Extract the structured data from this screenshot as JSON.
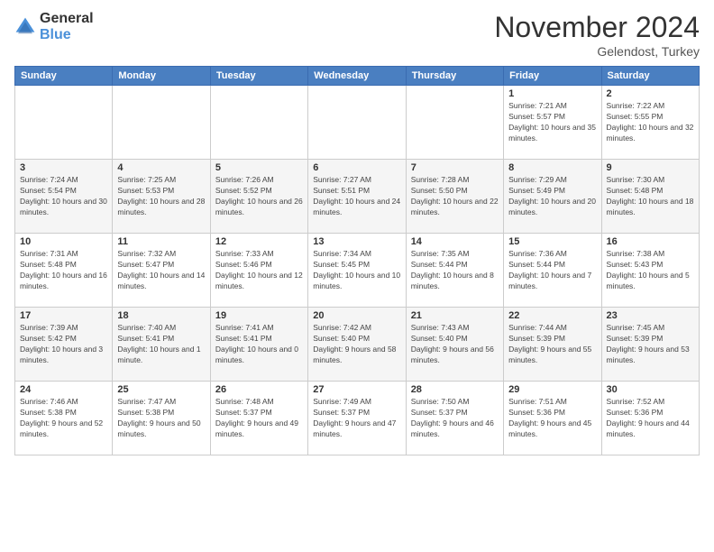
{
  "logo": {
    "general": "General",
    "blue": "Blue"
  },
  "header": {
    "month": "November 2024",
    "location": "Gelendost, Turkey"
  },
  "weekdays": [
    "Sunday",
    "Monday",
    "Tuesday",
    "Wednesday",
    "Thursday",
    "Friday",
    "Saturday"
  ],
  "weeks": [
    [
      {
        "day": "",
        "info": ""
      },
      {
        "day": "",
        "info": ""
      },
      {
        "day": "",
        "info": ""
      },
      {
        "day": "",
        "info": ""
      },
      {
        "day": "",
        "info": ""
      },
      {
        "day": "1",
        "info": "Sunrise: 7:21 AM\nSunset: 5:57 PM\nDaylight: 10 hours and 35 minutes."
      },
      {
        "day": "2",
        "info": "Sunrise: 7:22 AM\nSunset: 5:55 PM\nDaylight: 10 hours and 32 minutes."
      }
    ],
    [
      {
        "day": "3",
        "info": "Sunrise: 7:24 AM\nSunset: 5:54 PM\nDaylight: 10 hours and 30 minutes."
      },
      {
        "day": "4",
        "info": "Sunrise: 7:25 AM\nSunset: 5:53 PM\nDaylight: 10 hours and 28 minutes."
      },
      {
        "day": "5",
        "info": "Sunrise: 7:26 AM\nSunset: 5:52 PM\nDaylight: 10 hours and 26 minutes."
      },
      {
        "day": "6",
        "info": "Sunrise: 7:27 AM\nSunset: 5:51 PM\nDaylight: 10 hours and 24 minutes."
      },
      {
        "day": "7",
        "info": "Sunrise: 7:28 AM\nSunset: 5:50 PM\nDaylight: 10 hours and 22 minutes."
      },
      {
        "day": "8",
        "info": "Sunrise: 7:29 AM\nSunset: 5:49 PM\nDaylight: 10 hours and 20 minutes."
      },
      {
        "day": "9",
        "info": "Sunrise: 7:30 AM\nSunset: 5:48 PM\nDaylight: 10 hours and 18 minutes."
      }
    ],
    [
      {
        "day": "10",
        "info": "Sunrise: 7:31 AM\nSunset: 5:48 PM\nDaylight: 10 hours and 16 minutes."
      },
      {
        "day": "11",
        "info": "Sunrise: 7:32 AM\nSunset: 5:47 PM\nDaylight: 10 hours and 14 minutes."
      },
      {
        "day": "12",
        "info": "Sunrise: 7:33 AM\nSunset: 5:46 PM\nDaylight: 10 hours and 12 minutes."
      },
      {
        "day": "13",
        "info": "Sunrise: 7:34 AM\nSunset: 5:45 PM\nDaylight: 10 hours and 10 minutes."
      },
      {
        "day": "14",
        "info": "Sunrise: 7:35 AM\nSunset: 5:44 PM\nDaylight: 10 hours and 8 minutes."
      },
      {
        "day": "15",
        "info": "Sunrise: 7:36 AM\nSunset: 5:44 PM\nDaylight: 10 hours and 7 minutes."
      },
      {
        "day": "16",
        "info": "Sunrise: 7:38 AM\nSunset: 5:43 PM\nDaylight: 10 hours and 5 minutes."
      }
    ],
    [
      {
        "day": "17",
        "info": "Sunrise: 7:39 AM\nSunset: 5:42 PM\nDaylight: 10 hours and 3 minutes."
      },
      {
        "day": "18",
        "info": "Sunrise: 7:40 AM\nSunset: 5:41 PM\nDaylight: 10 hours and 1 minute."
      },
      {
        "day": "19",
        "info": "Sunrise: 7:41 AM\nSunset: 5:41 PM\nDaylight: 10 hours and 0 minutes."
      },
      {
        "day": "20",
        "info": "Sunrise: 7:42 AM\nSunset: 5:40 PM\nDaylight: 9 hours and 58 minutes."
      },
      {
        "day": "21",
        "info": "Sunrise: 7:43 AM\nSunset: 5:40 PM\nDaylight: 9 hours and 56 minutes."
      },
      {
        "day": "22",
        "info": "Sunrise: 7:44 AM\nSunset: 5:39 PM\nDaylight: 9 hours and 55 minutes."
      },
      {
        "day": "23",
        "info": "Sunrise: 7:45 AM\nSunset: 5:39 PM\nDaylight: 9 hours and 53 minutes."
      }
    ],
    [
      {
        "day": "24",
        "info": "Sunrise: 7:46 AM\nSunset: 5:38 PM\nDaylight: 9 hours and 52 minutes."
      },
      {
        "day": "25",
        "info": "Sunrise: 7:47 AM\nSunset: 5:38 PM\nDaylight: 9 hours and 50 minutes."
      },
      {
        "day": "26",
        "info": "Sunrise: 7:48 AM\nSunset: 5:37 PM\nDaylight: 9 hours and 49 minutes."
      },
      {
        "day": "27",
        "info": "Sunrise: 7:49 AM\nSunset: 5:37 PM\nDaylight: 9 hours and 47 minutes."
      },
      {
        "day": "28",
        "info": "Sunrise: 7:50 AM\nSunset: 5:37 PM\nDaylight: 9 hours and 46 minutes."
      },
      {
        "day": "29",
        "info": "Sunrise: 7:51 AM\nSunset: 5:36 PM\nDaylight: 9 hours and 45 minutes."
      },
      {
        "day": "30",
        "info": "Sunrise: 7:52 AM\nSunset: 5:36 PM\nDaylight: 9 hours and 44 minutes."
      }
    ]
  ]
}
